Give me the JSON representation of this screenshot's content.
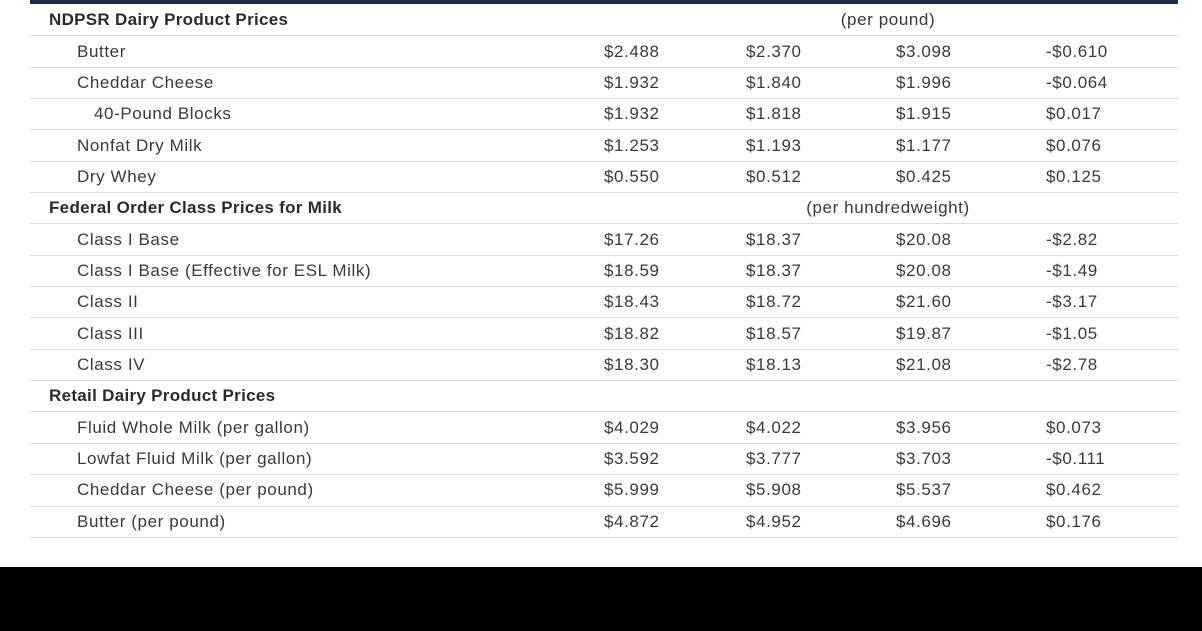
{
  "sections": [
    {
      "title": "NDPSR Dairy Product Prices",
      "unit": "(per pound)",
      "rows": [
        {
          "label": "Butter",
          "values": [
            "$2.488",
            "$2.370",
            "$3.098",
            "-$0.610"
          ]
        },
        {
          "label": "Cheddar Cheese",
          "values": [
            "$1.932",
            "$1.840",
            "$1.996",
            "-$0.064"
          ]
        },
        {
          "label": "40-Pound Blocks",
          "values": [
            "$1.932",
            "$1.818",
            "$1.915",
            "$0.017"
          ]
        },
        {
          "label": "Nonfat Dry Milk",
          "values": [
            "$1.253",
            "$1.193",
            "$1.177",
            "$0.076"
          ]
        },
        {
          "label": "Dry Whey",
          "values": [
            "$0.550",
            "$0.512",
            "$0.425",
            "$0.125"
          ]
        }
      ]
    },
    {
      "title": "Federal Order Class Prices for Milk",
      "unit": "(per hundredweight)",
      "rows": [
        {
          "label": "Class I Base",
          "values": [
            "$17.26",
            "$18.37",
            "$20.08",
            "-$2.82"
          ]
        },
        {
          "label": "Class I Base (Effective for ESL Milk)",
          "values": [
            "$18.59",
            "$18.37",
            "$20.08",
            "-$1.49"
          ]
        },
        {
          "label": "Class II",
          "values": [
            "$18.43",
            "$18.72",
            "$21.60",
            "-$3.17"
          ]
        },
        {
          "label": "Class III",
          "values": [
            "$18.82",
            "$18.57",
            "$19.87",
            "-$1.05"
          ]
        },
        {
          "label": "Class IV",
          "values": [
            "$18.30",
            "$18.13",
            "$21.08",
            "-$2.78"
          ]
        }
      ]
    },
    {
      "title": "Retail Dairy Product Prices",
      "unit": "",
      "rows": [
        {
          "label": "Fluid Whole Milk (per gallon)",
          "values": [
            "$4.029",
            "$4.022",
            "$3.956",
            "$0.073"
          ]
        },
        {
          "label": "Lowfat Fluid Milk (per gallon)",
          "values": [
            "$3.592",
            "$3.777",
            "$3.703",
            "-$0.111"
          ]
        },
        {
          "label": "Cheddar Cheese (per pound)",
          "values": [
            "$5.999",
            "$5.908",
            "$5.537",
            "$0.462"
          ]
        },
        {
          "label": "Butter (per pound)",
          "values": [
            "$4.872",
            "$4.952",
            "$4.696",
            "$0.176"
          ]
        }
      ]
    }
  ]
}
